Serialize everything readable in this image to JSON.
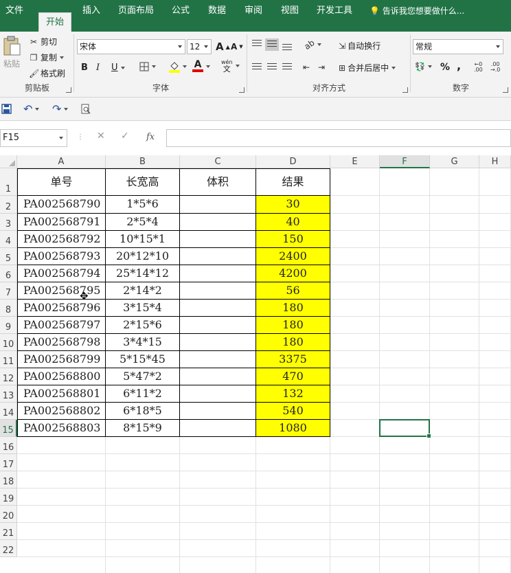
{
  "menu": {
    "tabs": [
      "文件",
      "开始",
      "插入",
      "页面布局",
      "公式",
      "数据",
      "审阅",
      "视图",
      "开发工具"
    ],
    "active_index": 1,
    "tell_me": "告诉我您想要做什么..."
  },
  "ribbon": {
    "clipboard": {
      "paste": "粘贴",
      "cut": "剪切",
      "copy": "复制",
      "format_painter": "格式刷",
      "label": "剪贴板"
    },
    "font": {
      "name": "宋体",
      "size": "12",
      "bold": "B",
      "italic": "I",
      "underline": "U",
      "grow": "A",
      "shrink": "A",
      "phonetic_top": "wén",
      "phonetic_bottom": "文",
      "font_color_glyph": "A",
      "label": "字体"
    },
    "alignment": {
      "wrap": "自动换行",
      "merge": "合并后居中",
      "label": "对齐方式"
    },
    "number": {
      "format": "常规",
      "percent": "%",
      "comma": ",",
      "label": "数字"
    }
  },
  "formula_bar": {
    "name_box": "F15",
    "cancel": "✕",
    "enter": "✓",
    "fx": "fx",
    "value": ""
  },
  "sheet": {
    "columns": [
      "A",
      "B",
      "C",
      "D",
      "E",
      "F",
      "G",
      "H"
    ],
    "selected_column": "F",
    "rows": [
      "1",
      "2",
      "3",
      "4",
      "5",
      "6",
      "7",
      "8",
      "9",
      "10",
      "11",
      "12",
      "13",
      "14",
      "15",
      "16",
      "17",
      "18",
      "19",
      "20",
      "21",
      "22"
    ],
    "selected_row": "15",
    "headers": [
      "单号",
      "长宽高",
      "体积",
      "结果"
    ],
    "data": [
      [
        "PA002568790",
        "1*5*6",
        "",
        "30"
      ],
      [
        "PA002568791",
        "2*5*4",
        "",
        "40"
      ],
      [
        "PA002568792",
        "10*15*1",
        "",
        "150"
      ],
      [
        "PA002568793",
        "20*12*10",
        "",
        "2400"
      ],
      [
        "PA002568794",
        "25*14*12",
        "",
        "4200"
      ],
      [
        "PA002568795",
        "2*14*2",
        "",
        "56"
      ],
      [
        "PA002568796",
        "3*15*4",
        "",
        "180"
      ],
      [
        "PA002568797",
        "2*15*6",
        "",
        "180"
      ],
      [
        "PA002568798",
        "3*4*15",
        "",
        "180"
      ],
      [
        "PA002568799",
        "5*15*45",
        "",
        "3375"
      ],
      [
        "PA002568800",
        "5*47*2",
        "",
        "470"
      ],
      [
        "PA002568801",
        "6*11*2",
        "",
        "132"
      ],
      [
        "PA002568802",
        "6*18*5",
        "",
        "540"
      ],
      [
        "PA002568803",
        "8*15*9",
        "",
        "1080"
      ]
    ],
    "highlight_color": "#ffff00",
    "accent_color": "#217346"
  }
}
